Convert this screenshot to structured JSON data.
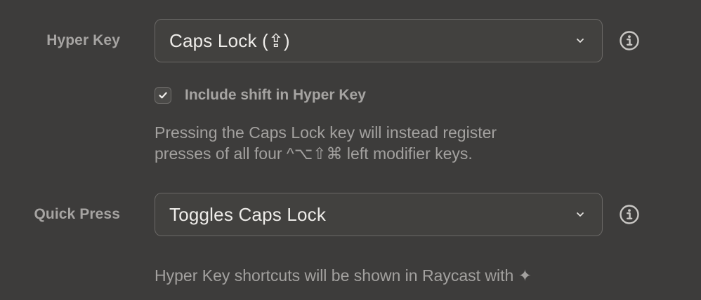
{
  "hyper_key": {
    "label": "Hyper Key",
    "selected": "Caps Lock (⇪)",
    "include_shift": {
      "label": "Include shift in Hyper Key",
      "checked": true
    },
    "description_line1": "Pressing the Caps Lock key will instead register",
    "description_line2": "presses of all four ^⌥⇧⌘ left modifier keys."
  },
  "quick_press": {
    "label": "Quick Press",
    "selected": "Toggles Caps Lock",
    "footnote": "Hyper Key shortcuts will be shown in Raycast with ✦"
  },
  "icons": {
    "dropdown": "chevron-down-icon",
    "info": "info-icon",
    "check": "checkmark-icon"
  },
  "colors": {
    "background": "#3d3c3b",
    "field_border": "#6a6866",
    "label_text": "#a6a4a2",
    "value_text": "#eeece9"
  }
}
